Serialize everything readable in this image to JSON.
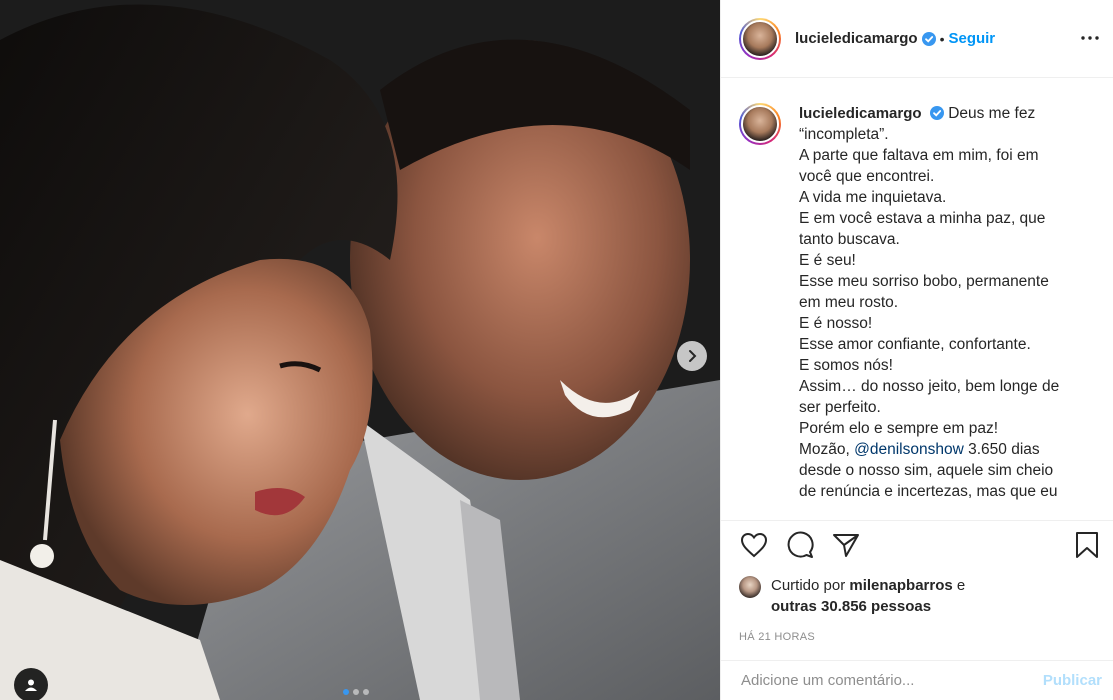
{
  "post": {
    "username": "lucieledicamargo",
    "follow_label": "Seguir",
    "bullet": "•",
    "caption_lines": [
      "Deus me fez",
      "“incompleta”.",
      "A parte que faltava em mim, foi em",
      "você que encontrei.",
      "A vida me inquietava.",
      "E em você estava a minha paz, que",
      "tanto buscava.",
      "E é seu!",
      "Esse meu sorriso bobo, permanente",
      "em meu rosto.",
      "E é nosso!",
      "Esse amor confiante, confortante.",
      "E somos nós!",
      "Assim… do nosso jeito, bem longe de",
      "ser perfeito.",
      "Porém elo e sempre em paz!"
    ],
    "caption_mention_prefix": "Mozão, ",
    "caption_mention": "@denilsonshow",
    "caption_mention_suffix": " 3.650 dias",
    "caption_tail_lines": [
      "desde o nosso sim, aquele sim cheio",
      "de renúncia e incertezas, mas que eu"
    ],
    "likes": {
      "prefix": "Curtido por ",
      "liker": "milenapbarros",
      "connector": " e",
      "others": "outras 30.856 pessoas"
    },
    "time": "HÁ 21 HORAS",
    "comment_placeholder": "Adicione um comentário...",
    "publish_label": "Publicar"
  },
  "colors": {
    "accent": "#0095f6",
    "verified": "#3897f0",
    "publish_disabled": "#b2dffc"
  },
  "icons": [
    "heart-icon",
    "comment-icon",
    "share-icon",
    "bookmark-icon",
    "more-icon",
    "chevron-right-icon",
    "tag-person-icon",
    "verified-badge-icon"
  ]
}
